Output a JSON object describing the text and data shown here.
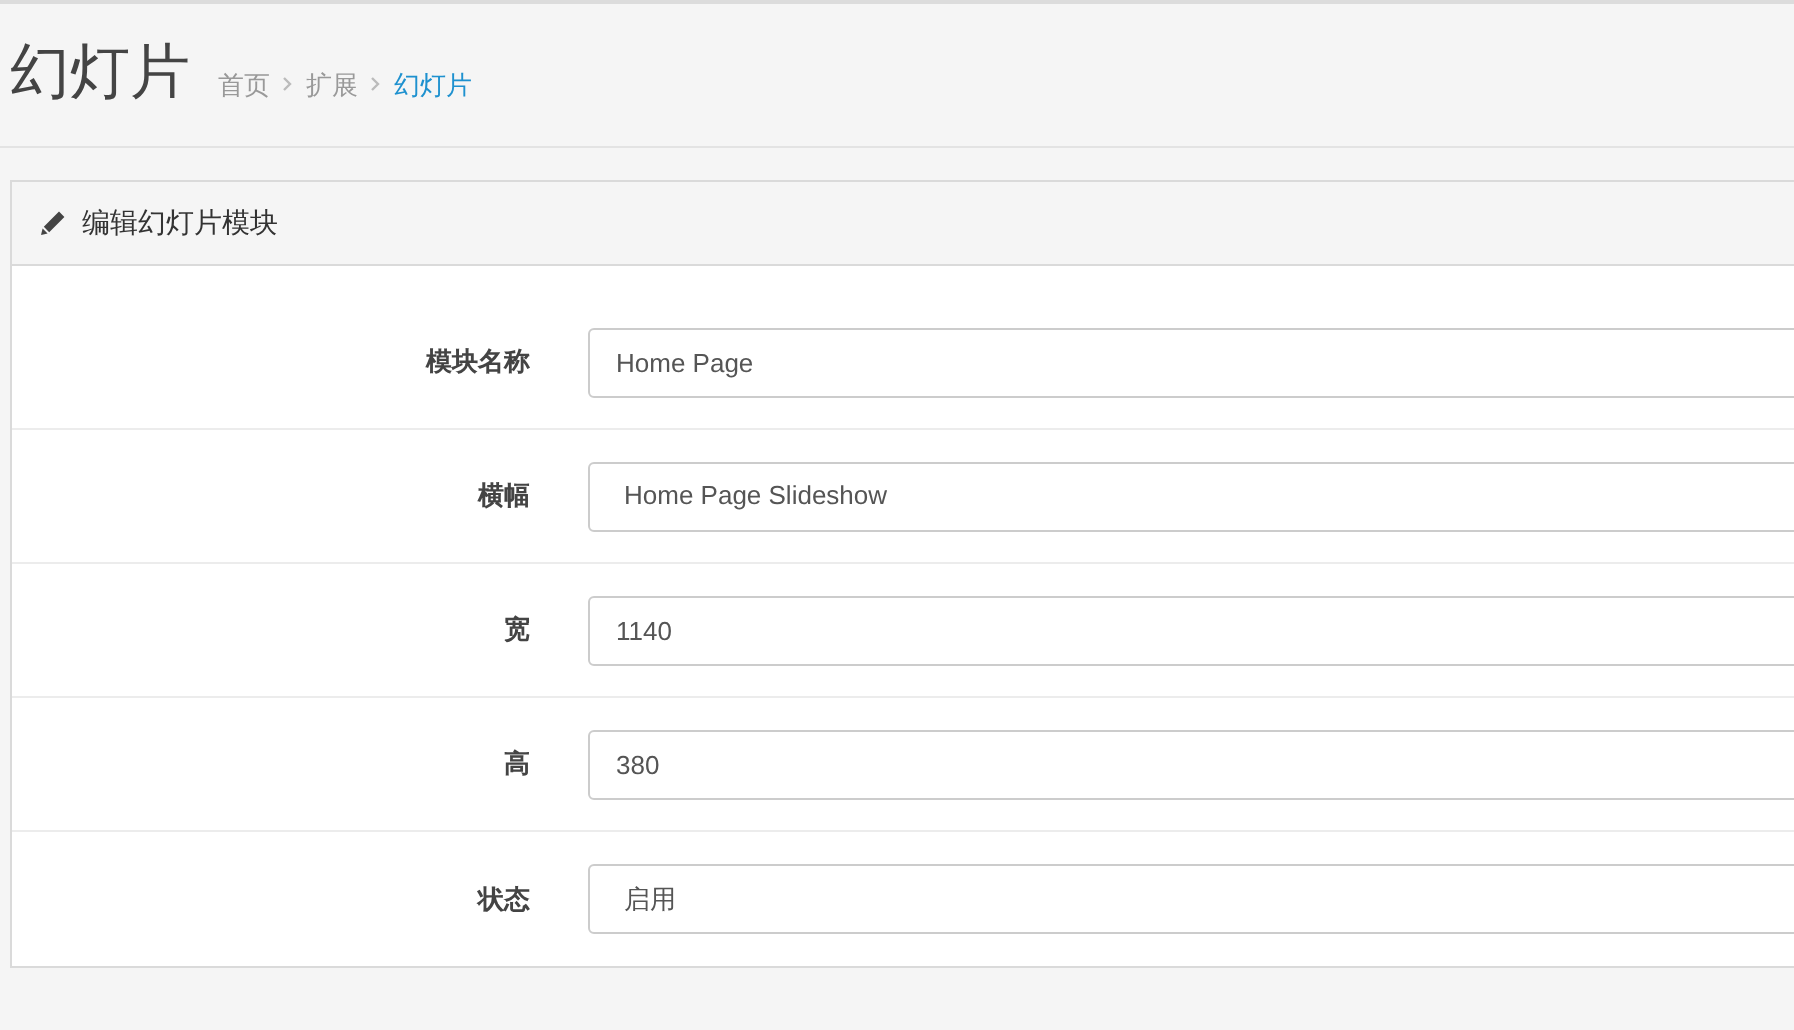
{
  "page_title": "幻灯片",
  "breadcrumb": [
    {
      "label": "首页",
      "selected": false
    },
    {
      "label": "扩展",
      "selected": false
    },
    {
      "label": "幻灯片",
      "selected": true
    }
  ],
  "panel": {
    "title": "编辑幻灯片模块",
    "fields": [
      {
        "label": "模块名称",
        "kind": "text",
        "value": "Home Page"
      },
      {
        "label": "横幅",
        "kind": "select",
        "value": "Home Page Slideshow"
      },
      {
        "label": "宽",
        "kind": "text",
        "value": "1140"
      },
      {
        "label": "高",
        "kind": "text",
        "value": "380"
      },
      {
        "label": "状态",
        "kind": "select",
        "value": "启用"
      }
    ]
  }
}
